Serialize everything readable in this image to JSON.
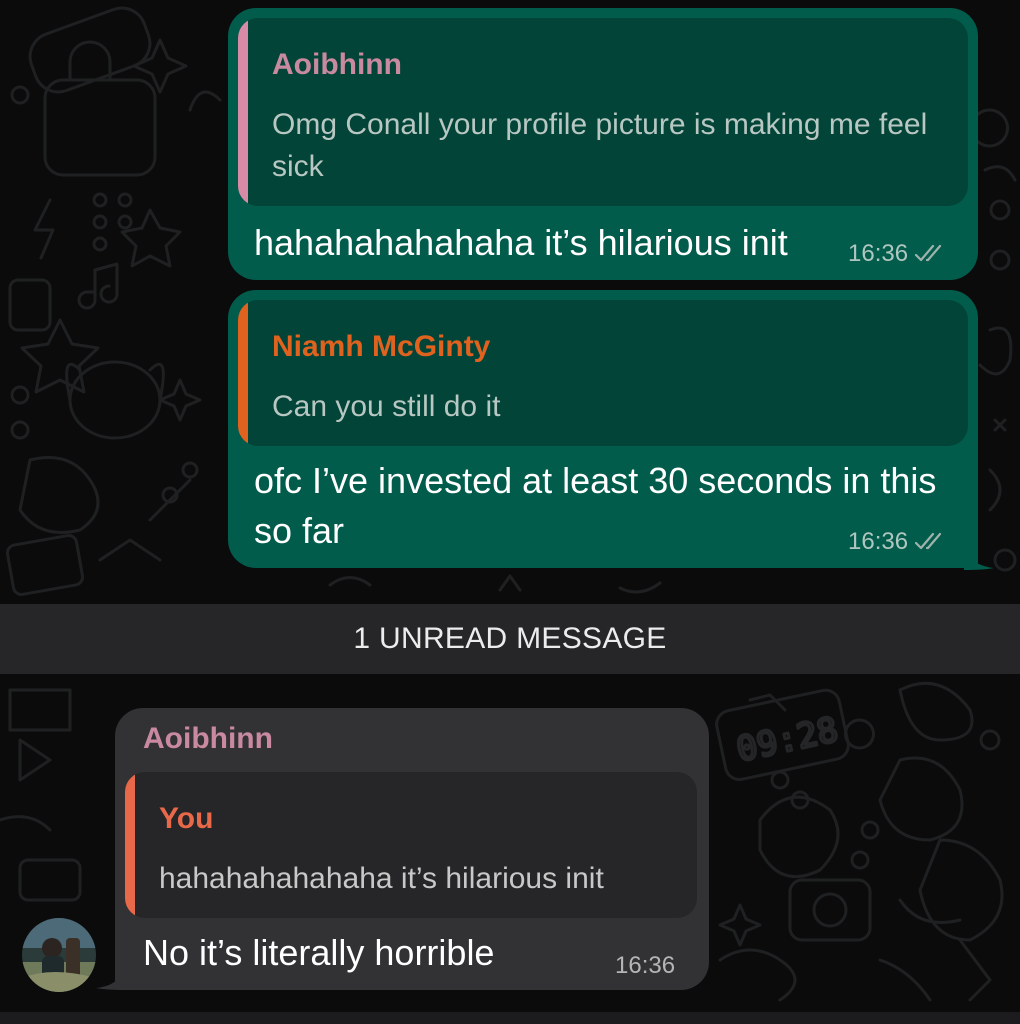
{
  "messages": [
    {
      "quote": {
        "author": "Aoibhinn",
        "text": "Omg Conall your profile picture is making me feel sick"
      },
      "text": "hahahahahahaha it’s hilarious init",
      "time": "16:36"
    },
    {
      "quote": {
        "author": "Niamh McGinty",
        "text": "Can you still do it"
      },
      "text": "ofc I’ve invested at least 30 seconds in this so far",
      "time": "16:36"
    }
  ],
  "unread_banner": "1 UNREAD MESSAGE",
  "incoming": {
    "sender": "Aoibhinn",
    "quote": {
      "author": "You",
      "text": "hahahahahahaha it’s hilarious init"
    },
    "text": "No it’s literally horrible",
    "time": "16:36"
  },
  "colors": {
    "outgoing_bubble": "#015c4b",
    "incoming_bubble": "#323235",
    "author_aoibhinn": "#c98aa0",
    "author_niamh": "#e0621f",
    "author_you": "#e8694a",
    "read_ticks": "#9fb3ad"
  }
}
